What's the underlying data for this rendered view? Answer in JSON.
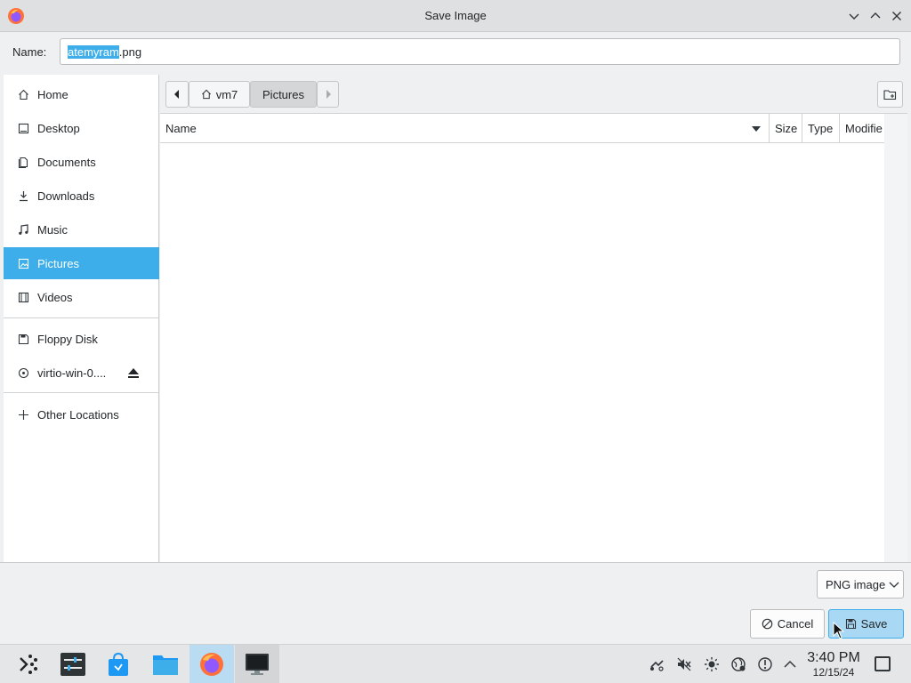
{
  "window": {
    "title": "Save Image"
  },
  "name_row": {
    "label": "Name:",
    "filename_selected": "atemyram",
    "filename_rest": ".png"
  },
  "sidebar": {
    "places": [
      {
        "label": "Home",
        "icon": "home-icon"
      },
      {
        "label": "Desktop",
        "icon": "desktop-icon"
      },
      {
        "label": "Documents",
        "icon": "documents-icon"
      },
      {
        "label": "Downloads",
        "icon": "downloads-icon"
      },
      {
        "label": "Music",
        "icon": "music-icon"
      },
      {
        "label": "Pictures",
        "icon": "pictures-icon",
        "active": true
      },
      {
        "label": "Videos",
        "icon": "videos-icon"
      }
    ],
    "devices": [
      {
        "label": "Floppy Disk",
        "icon": "floppy-icon"
      },
      {
        "label": "virtio-win-0....",
        "icon": "disc-icon",
        "ejectable": true
      }
    ],
    "other": {
      "label": "Other Locations",
      "icon": "plus-icon"
    }
  },
  "pathbar": {
    "crumbs": [
      "vm7",
      "Pictures"
    ]
  },
  "columns": {
    "name": "Name",
    "size": "Size",
    "type": "Type",
    "modified": "Modifie"
  },
  "bottom": {
    "file_type": "PNG image",
    "cancel_label": "Cancel",
    "save_label": "Save"
  },
  "taskbar": {
    "time": "3:40 PM",
    "date": "12/15/24"
  },
  "colors": {
    "accent": "#3daee9",
    "save_bg": "#a8d8f3"
  }
}
